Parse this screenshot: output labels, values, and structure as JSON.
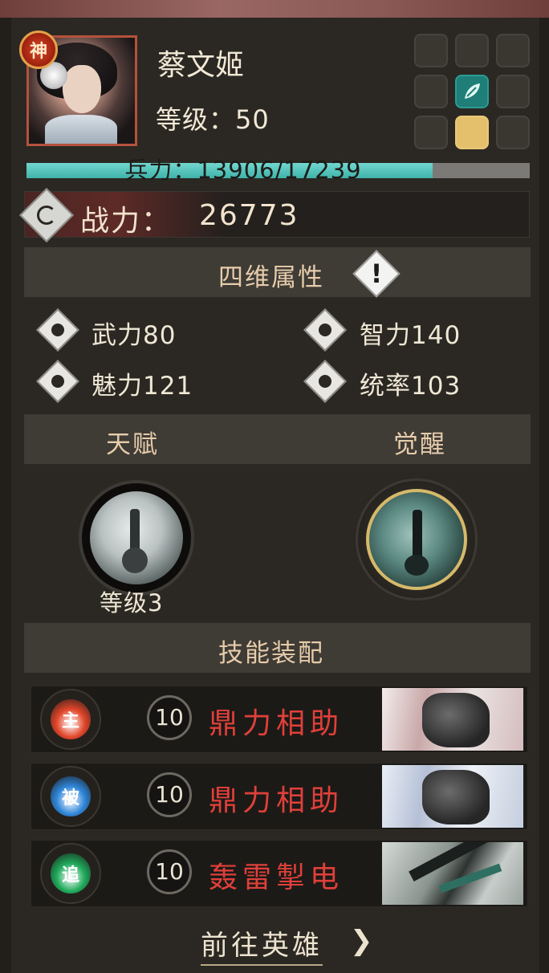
{
  "hero": {
    "name": "蔡文姬",
    "level_text": "等级：50",
    "badge": "神"
  },
  "troops": {
    "text": "兵力：13906/17239",
    "current": 13906,
    "max": 17239
  },
  "power": {
    "label": "战力：",
    "value": "26773"
  },
  "attributes": {
    "title": "四维属性",
    "warn_mark": "!",
    "stats": [
      {
        "label": "武力",
        "value": "80",
        "icon": "sword-icon"
      },
      {
        "label": "智力",
        "value": "140",
        "icon": "book-icon"
      },
      {
        "label": "魅力",
        "value": "121",
        "icon": "flower-icon"
      },
      {
        "label": "统率",
        "value": "103",
        "icon": "flag-icon"
      }
    ]
  },
  "tabs": {
    "talent": "天赋",
    "awaken": "觉醒"
  },
  "talent": {
    "level_text": "等级3"
  },
  "skills": {
    "title": "技能装配",
    "items": [
      {
        "type": "主",
        "type_color": "#e2462a",
        "level": "10",
        "name": "鼎力相助"
      },
      {
        "type": "被",
        "type_color": "#2f86d9",
        "level": "10",
        "name": "鼎力相助"
      },
      {
        "type": "追",
        "type_color": "#1faa5b",
        "level": "10",
        "name": "轰雷掣电"
      }
    ]
  },
  "footer": {
    "goto_label": "前往英雄",
    "arrow": "❯"
  },
  "colors": {
    "troop_fill": "#4fc2ba",
    "power_value": "#f2e3cd",
    "skill_name": "#e0403a",
    "grid_teal": "#1f7e78",
    "grid_gold": "#e4c06c"
  }
}
